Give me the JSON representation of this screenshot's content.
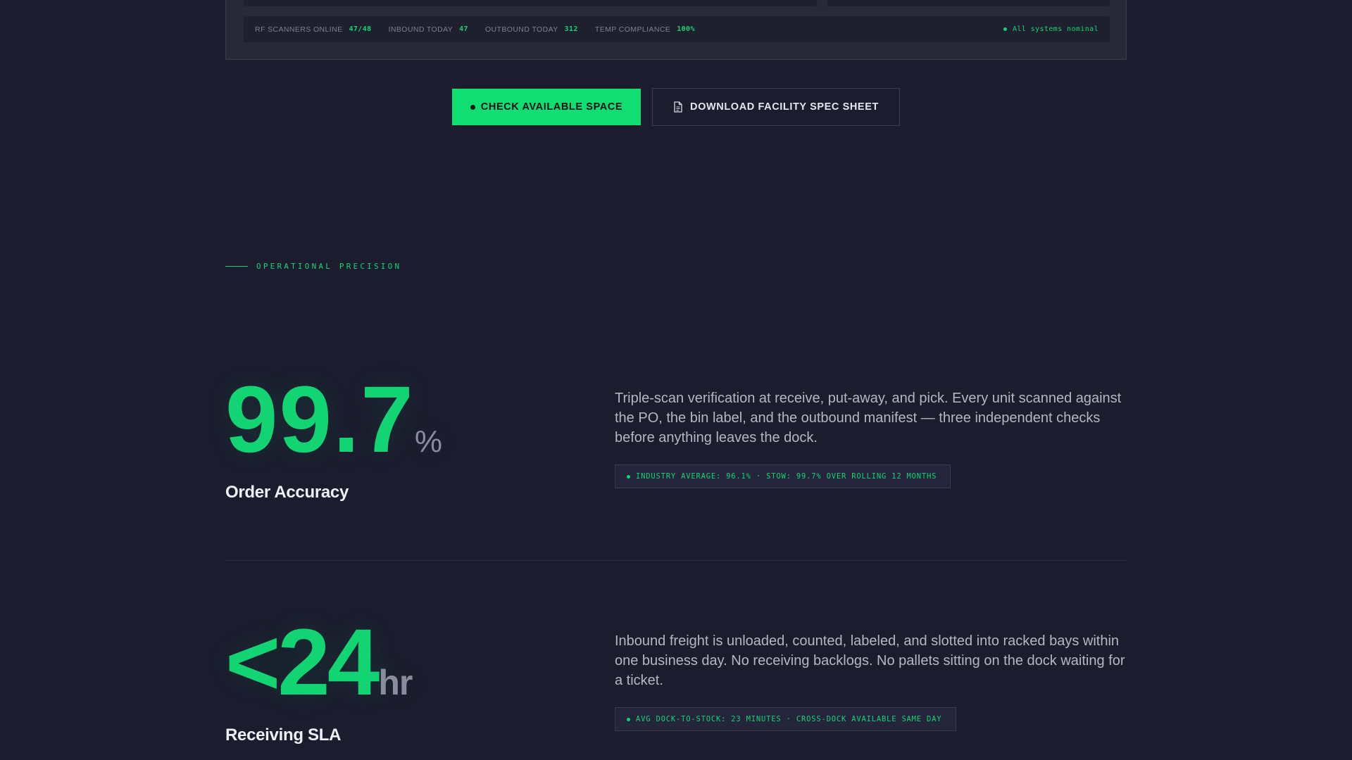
{
  "status_bar": {
    "stats": [
      {
        "label": "RF SCANNERS ONLINE",
        "value": "47/48"
      },
      {
        "label": "INBOUND TODAY",
        "value": "47"
      },
      {
        "label": "OUTBOUND TODAY",
        "value": "312"
      },
      {
        "label": "TEMP COMPLIANCE",
        "value": "100%"
      }
    ],
    "system_status": "All systems nominal"
  },
  "cta": {
    "primary_label": "CHECK AVAILABLE SPACE",
    "secondary_label": "DOWNLOAD FACILITY SPEC SHEET",
    "secondary_icon": "document-icon"
  },
  "section": {
    "eyebrow": "OPERATIONAL PRECISION"
  },
  "metrics": [
    {
      "value": "99.7",
      "unit": "%",
      "label": "Order Accuracy",
      "description": "Triple-scan verification at receive, put-away, and pick. Every unit scanned against the PO, the bin label, and the outbound manifest — three independent checks before anything leaves the dock.",
      "tag": "INDUSTRY AVERAGE: 96.1% · STOW: 99.7% OVER ROLLING 12 MONTHS"
    },
    {
      "value": "<24",
      "unit": "hr",
      "label": "Receiving SLA",
      "description": "Inbound freight is unloaded, counted, labeled, and slotted into racked bays within one business day. No receiving backlogs. No pallets sitting on the dock waiting for a ticket.",
      "tag": "AVG DOCK-TO-STOCK: 23 MINUTES · CROSS-DOCK AVAILABLE SAME DAY"
    }
  ],
  "colors": {
    "background": "#1b1c2e",
    "accent": "#11de72",
    "muted": "#8a8c9e"
  }
}
